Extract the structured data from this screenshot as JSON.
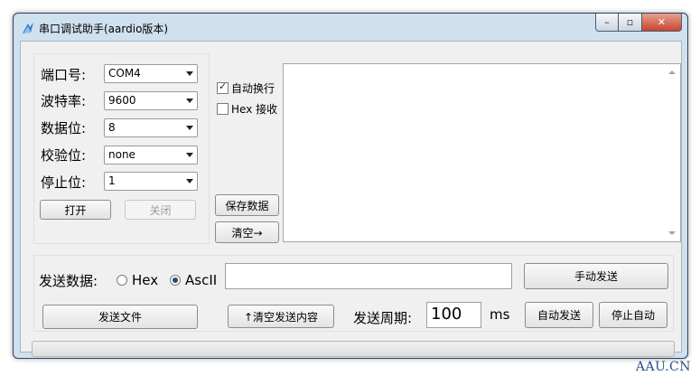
{
  "window": {
    "title": "串口调试助手(aardio版本)",
    "minimize_glyph": "–",
    "maximize_glyph": "▫",
    "close_glyph": "✕"
  },
  "serial": {
    "port_label": "端口号:",
    "port_value": "COM4",
    "baud_label": "波特率:",
    "baud_value": "9600",
    "databits_label": "数据位:",
    "databits_value": "8",
    "parity_label": "校验位:",
    "parity_value": "none",
    "stopbits_label": "停止位:",
    "stopbits_value": "1",
    "open_label": "打开",
    "close_label": "关闭"
  },
  "receive": {
    "auto_wrap_label": "自动换行",
    "auto_wrap_checked": true,
    "hex_recv_label": "Hex 接收",
    "hex_recv_checked": false,
    "save_label": "保存数据",
    "clear_label": "清空→",
    "content": ""
  },
  "send": {
    "data_label": "发送数据:",
    "hex_label": "Hex",
    "ascii_label": "AscII",
    "mode_selected": "AscII",
    "input_value": "",
    "manual_send_label": "手动发送",
    "send_file_label": "发送文件",
    "clear_send_label": "↑清空发送内容",
    "period_label": "发送周期:",
    "period_value": "100",
    "period_unit": "ms",
    "auto_send_label": "自动发送",
    "stop_auto_label": "停止自动"
  },
  "progress": {
    "value": 0
  },
  "watermark": "AAU.CN",
  "icons": {
    "app": "serial-app-icon",
    "dropdown": "chevron-down-icon"
  },
  "colors": {
    "frame": "#cfe0ef",
    "client": "#f0f0f0",
    "close_button": "#c7452e",
    "watermark": "#2a4f85"
  }
}
